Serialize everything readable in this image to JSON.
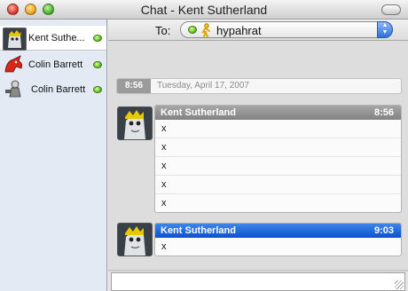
{
  "window": {
    "title": "Chat - Kent Sutherland"
  },
  "sidebar": {
    "tabs": [
      {
        "label": "Kent Suthe...",
        "status": "available"
      },
      {
        "label": "Colin Barrett",
        "status": "available"
      },
      {
        "label": "Colin Barrett",
        "status": "available"
      }
    ]
  },
  "to_bar": {
    "label": "To:",
    "recipient": "hypahrat"
  },
  "transcript": {
    "date_header": {
      "time": "8:56",
      "date": "Tuesday, April 17, 2007"
    },
    "messages": [
      {
        "sender": "Kent Sutherland",
        "time": "8:56",
        "lines": [
          "x",
          "x",
          "x",
          "x",
          "x"
        ]
      },
      {
        "sender": "Kent Sutherland",
        "time": "9:03",
        "lines": [
          "x"
        ]
      }
    ]
  },
  "colors": {
    "status_green": "#5fbf19",
    "incoming_header": "#8f8f8f",
    "selected_header": "#0b52c8"
  },
  "icons": [
    "close-icon",
    "minimize-icon",
    "zoom-icon",
    "toolbar-toggle-icon",
    "status-available-icon",
    "aim-service-icon",
    "stepper-icon"
  ]
}
